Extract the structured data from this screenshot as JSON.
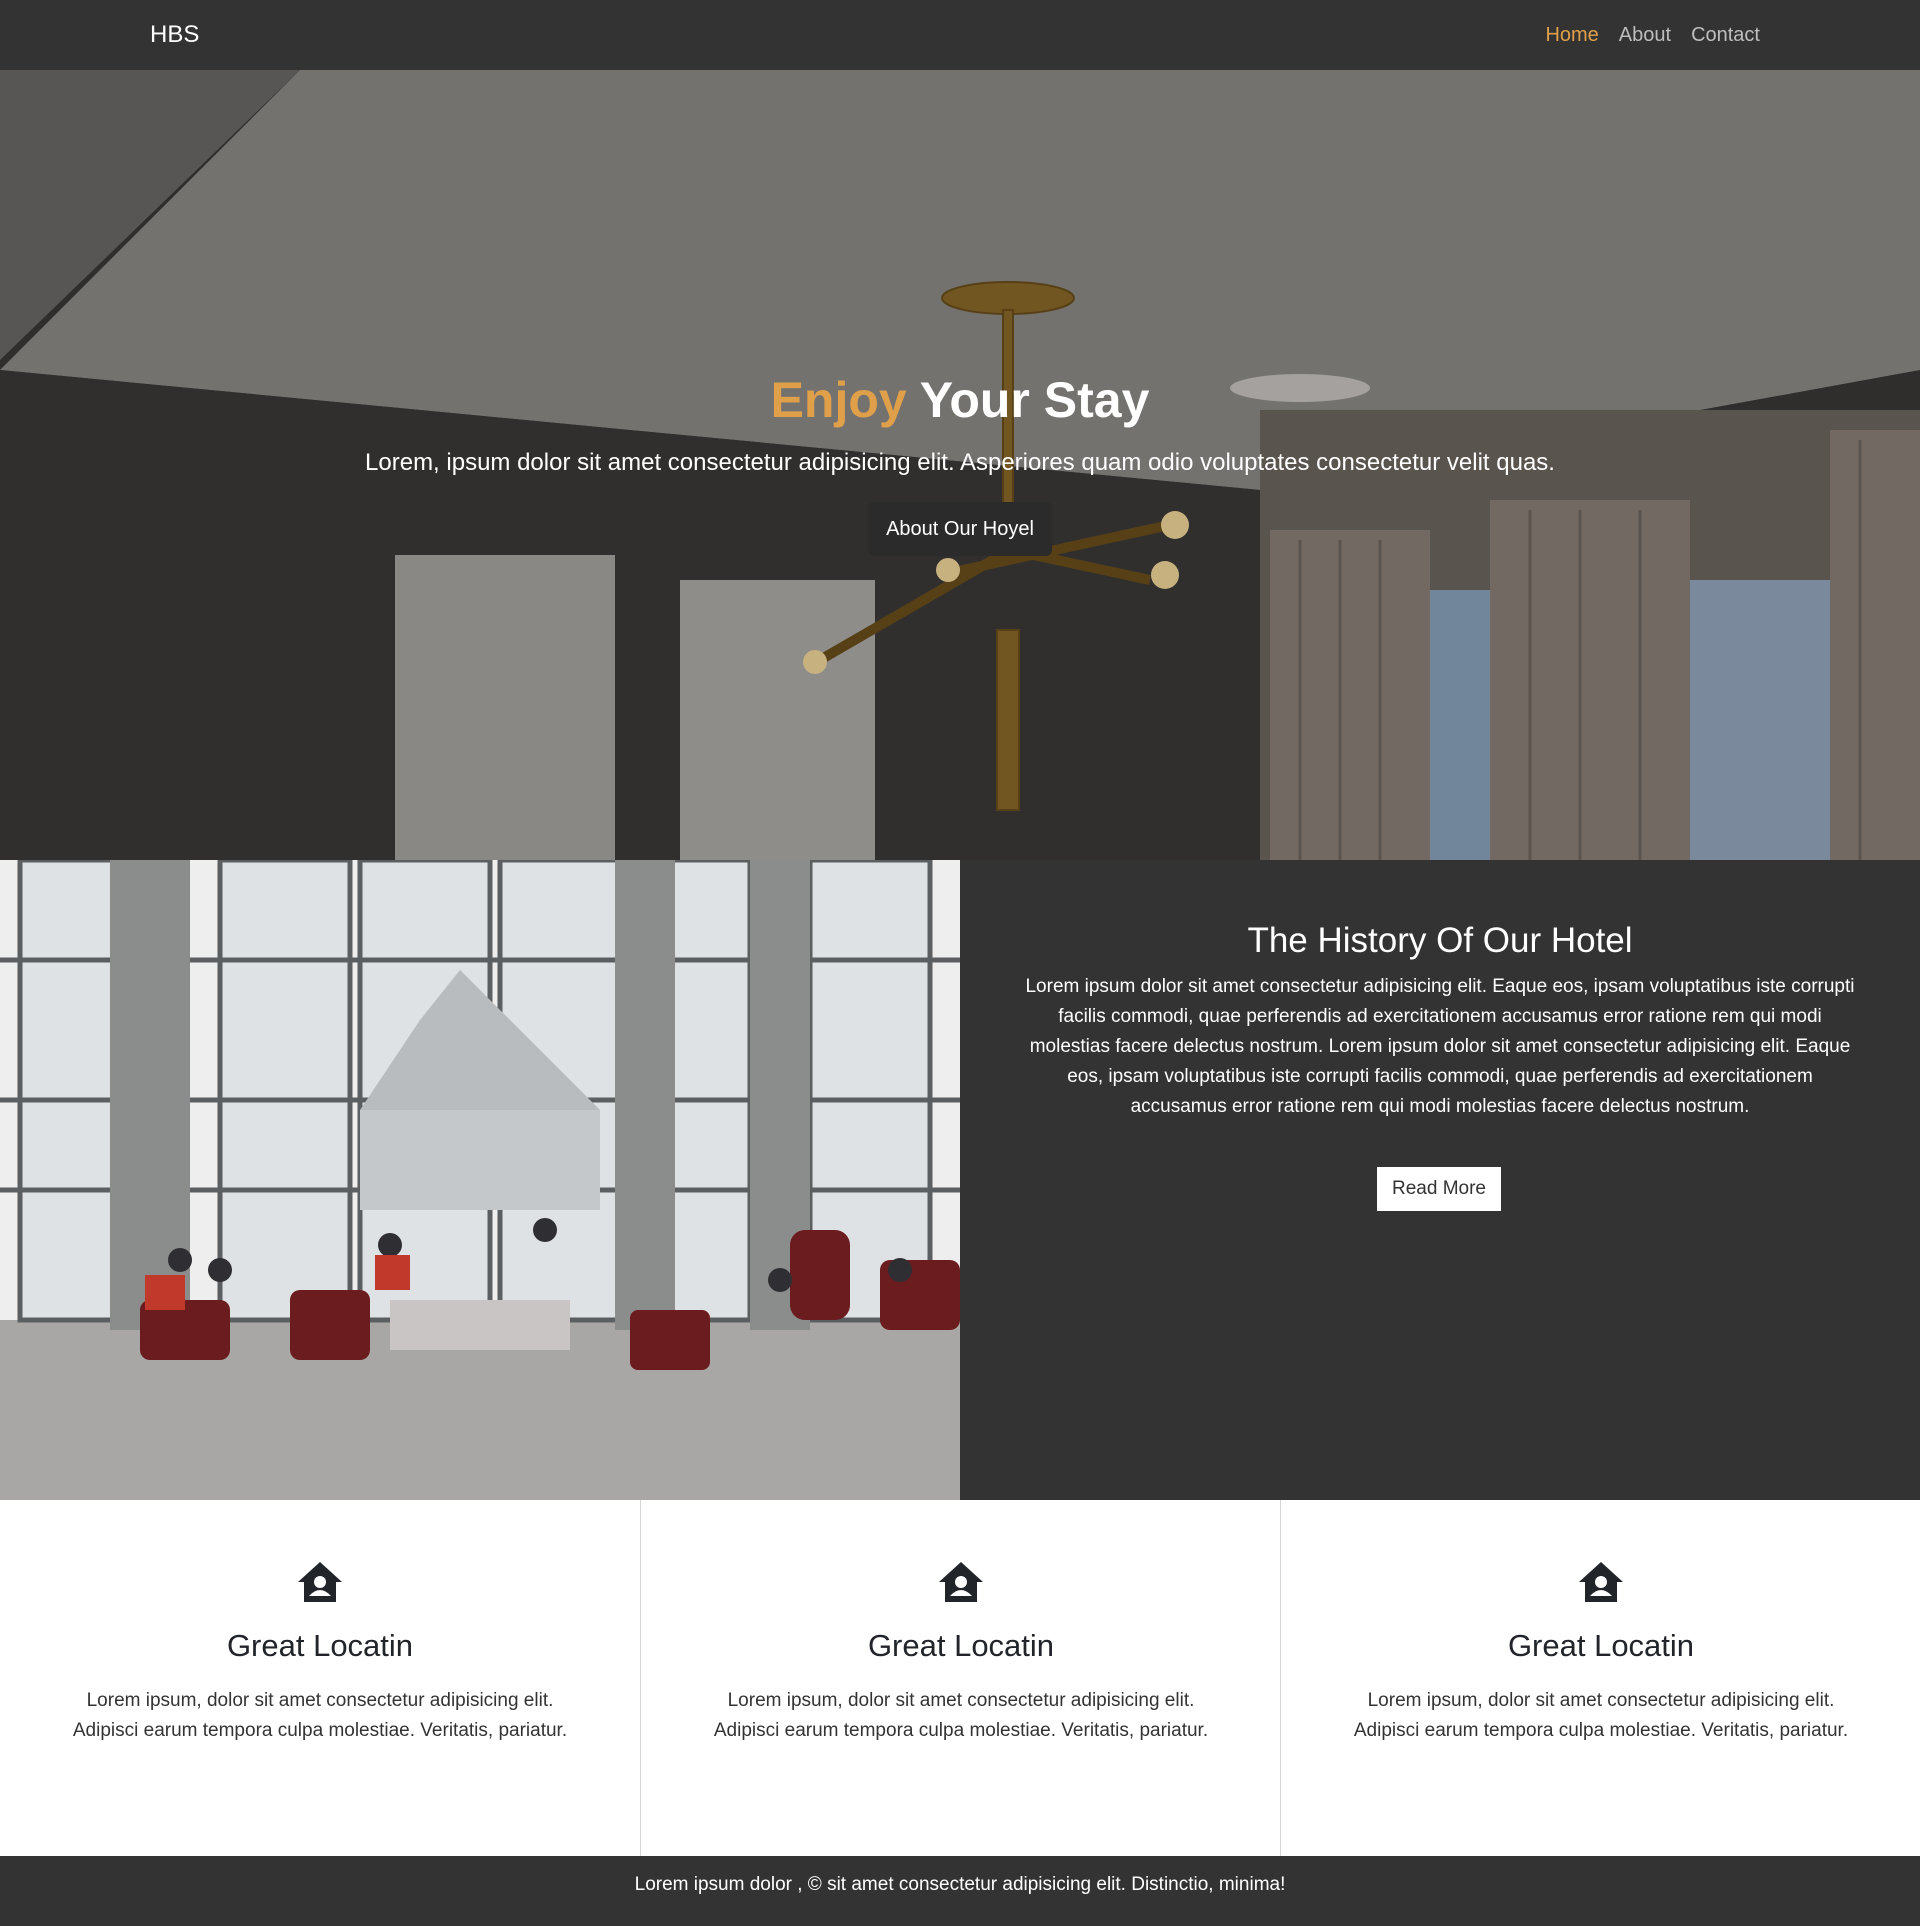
{
  "nav": {
    "brand": "HBS",
    "links": [
      "Home",
      "About",
      "Contact"
    ],
    "active_color": "#e0a04a"
  },
  "hero": {
    "title_accent": "Enjoy",
    "title_rest": " Your Stay",
    "subtitle": "Lorem, ipsum dolor sit amet consectetur adipisicing elit. Asperiores quam odio voluptates consectetur velit quas.",
    "button_label": "About Our Hoyel"
  },
  "history": {
    "title": "The History Of Our Hotel",
    "text": "Lorem ipsum dolor sit amet consectetur adipisicing elit. Eaque eos, ipsam voluptatibus iste corrupti facilis commodi, quae perferendis ad exercitationem accusamus error ratione rem qui modi molestias facere delectus nostrum. Lorem ipsum dolor sit amet consectetur adipisicing elit. Eaque eos, ipsam voluptatibus iste corrupti facilis commodi, quae perferendis ad exercitationem accusamus error ratione rem qui modi molestias facere delectus nostrum.",
    "button_label": "Read More"
  },
  "features": [
    {
      "icon": "house-user-icon",
      "title": "Great Locatin",
      "text": "Lorem ipsum, dolor sit amet consectetur adipisicing elit. Adipisci earum tempora culpa molestiae. Veritatis, pariatur."
    },
    {
      "icon": "house-user-icon",
      "title": "Great Locatin",
      "text": "Lorem ipsum, dolor sit amet consectetur adipisicing elit. Adipisci earum tempora culpa molestiae. Veritatis, pariatur."
    },
    {
      "icon": "house-user-icon",
      "title": "Great Locatin",
      "text": "Lorem ipsum, dolor sit amet consectetur adipisicing elit. Adipisci earum tempora culpa molestiae. Veritatis, pariatur."
    }
  ],
  "footer": {
    "text": "Lorem ipsum dolor , © sit amet consectetur adipisicing elit. Distinctio, minima!"
  }
}
